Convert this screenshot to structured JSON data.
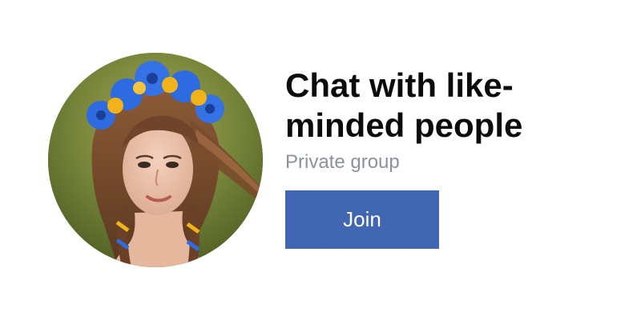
{
  "group_card": {
    "title": "Chat with like-minded people",
    "subtitle": "Private group",
    "join_label": "Join",
    "avatar_icon": "group-photo-avatar",
    "colors": {
      "button_bg": "#4267b2",
      "button_text": "#ffffff",
      "title_text": "#0b0b0b",
      "subtitle_text": "#8c929a",
      "flower_blue": "#2f6be0",
      "flower_yellow": "#f2b21a"
    }
  }
}
